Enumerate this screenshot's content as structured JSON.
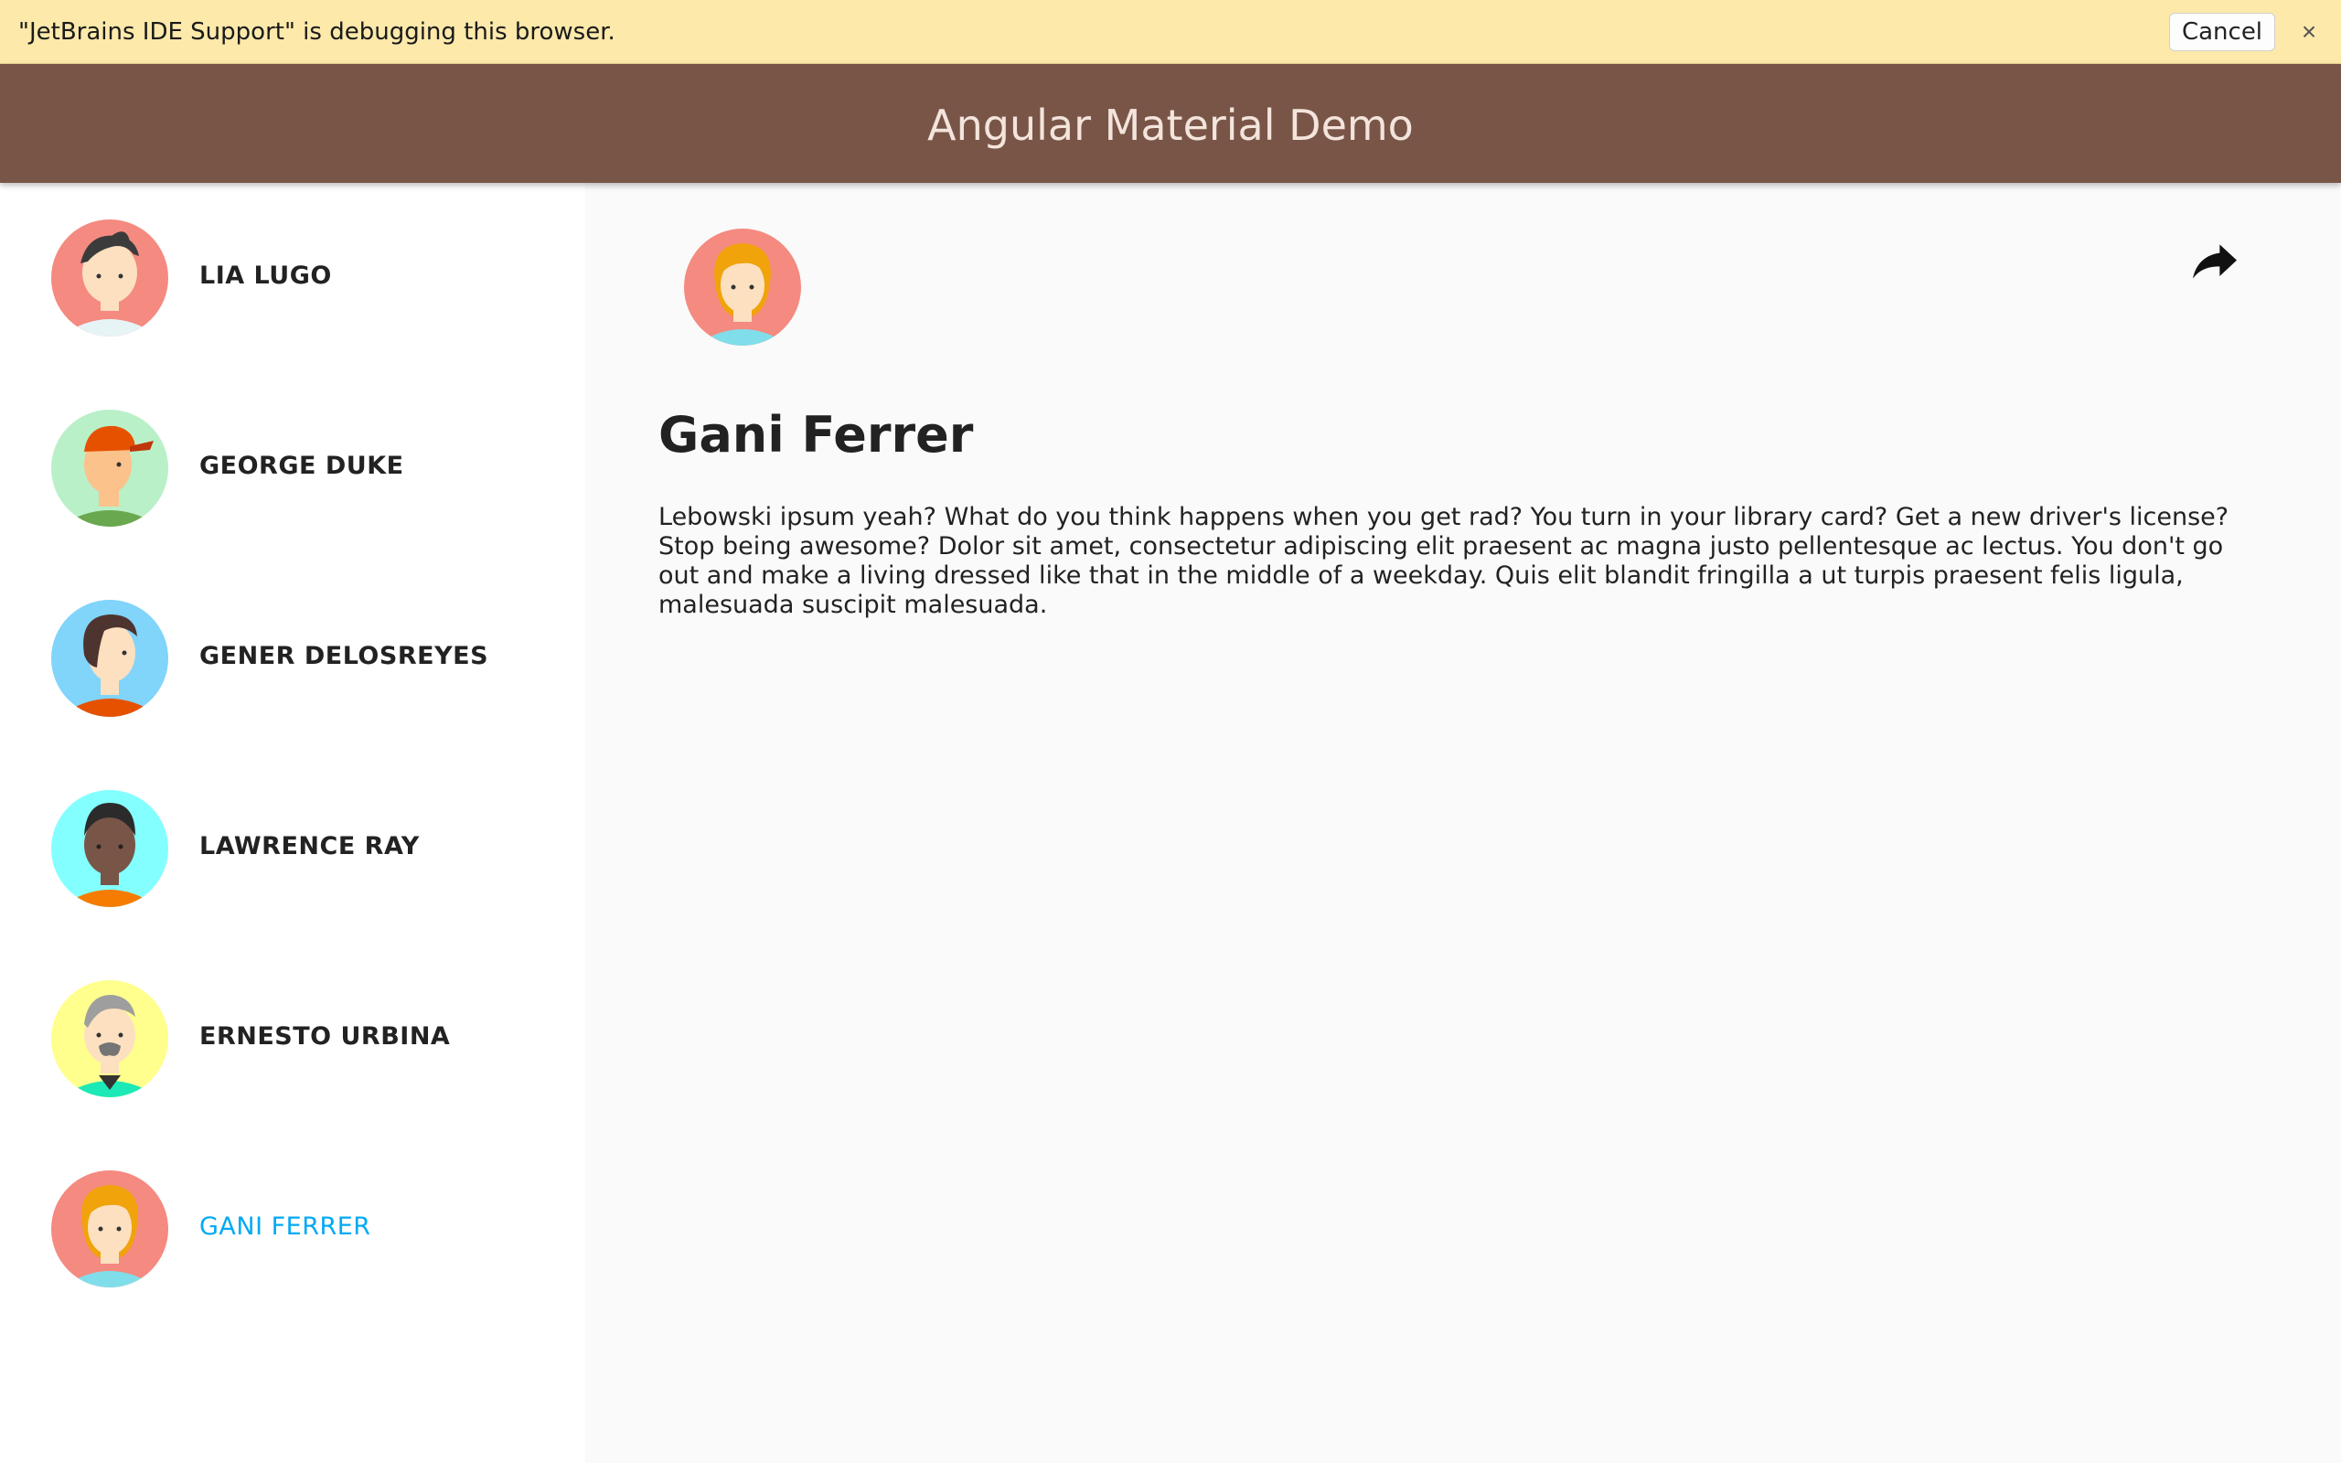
{
  "debug_bar": {
    "message": "\"JetBrains IDE Support\" is debugging this browser.",
    "cancel_label": "Cancel",
    "close_label": "×"
  },
  "toolbar": {
    "title": "Angular Material Demo"
  },
  "users": [
    {
      "name": "LIA LUGO",
      "avatar_icon": "female-avatar-icon",
      "selected": false
    },
    {
      "name": "GEORGE DUKE",
      "avatar_icon": "male-cap-avatar-icon",
      "selected": false
    },
    {
      "name": "GENER DELOSREYES",
      "avatar_icon": "male-avatar-icon",
      "selected": false
    },
    {
      "name": "LAWRENCE RAY",
      "avatar_icon": "male-dark-avatar-icon",
      "selected": false
    },
    {
      "name": "ERNESTO URBINA",
      "avatar_icon": "elder-avatar-icon",
      "selected": false
    },
    {
      "name": "GANI FERRER",
      "avatar_icon": "female-blonde-avatar-icon",
      "selected": true
    }
  ],
  "detail": {
    "name": "Gani Ferrer",
    "content": "Lebowski ipsum yeah? What do you think happens when you get rad? You turn in your library card? Get a new driver's license? Stop being awesome? Dolor sit amet, consectetur adipiscing elit praesent ac magna justo pellentesque ac lectus. You don't go out and make a living dressed like that in the middle of a weekday. Quis elit blandit fringilla a ut turpis praesent felis ligula, malesuada suscipit malesuada.",
    "share_icon": "share-icon"
  },
  "colors": {
    "toolbar": "#795548",
    "accent": "#03a9f4",
    "debug_bar": "#fde9aa"
  }
}
